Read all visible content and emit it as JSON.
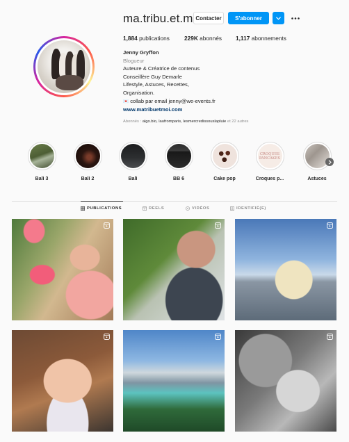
{
  "profile": {
    "username": "ma.tribu.et.moi",
    "contact_label": "Contacter",
    "follow_label": "S'abonner",
    "stats": {
      "posts_count": "1,884",
      "posts_label": "publications",
      "followers_count": "229K",
      "followers_label": "abonnés",
      "following_count": "1,117",
      "following_label": "abonnements"
    },
    "bio": {
      "name": "Jenny Gryffon",
      "category": "Blogueur",
      "line1": "Auteure & Créatrice de contenus",
      "line2": "Conseillère Guy Demarle",
      "line3": "Lifestyle, Astuces, Recettes,",
      "line4": "Organisation.",
      "line5_emoji": "💌",
      "line5": " collab par email jenny@we-events.fr",
      "website": "www.matribuetmoi.com"
    },
    "followed_by_prefix": "Abonnés : ",
    "followed_by_names": "algo.bio, laufromparis, lesmercredissouslapluie",
    "followed_by_suffix": " et 22 autres"
  },
  "highlights": [
    {
      "label": "Bali 3"
    },
    {
      "label": "Bali 2"
    },
    {
      "label": "Bali"
    },
    {
      "label": "BB 6"
    },
    {
      "label": "Cake pop"
    },
    {
      "label": "Croques p..."
    },
    {
      "label": "Astuces"
    }
  ],
  "highlight_thumb_text": {
    "line1": "CROQUES",
    "line2": "PANCAKES"
  },
  "tabs": {
    "publications": "PUBLICATIONS",
    "reels": "REELS",
    "videos": "VIDÉOS",
    "tagged": "IDENTIFIÉ(E)"
  },
  "icons": {
    "more": "more-options-icon",
    "dropdown": "chevron-down-icon",
    "next": "chevron-right-icon",
    "grid": "grid-icon",
    "reels": "reels-icon",
    "videos": "play-icon",
    "tagged": "tag-icon",
    "reel_badge": "reel-badge-icon"
  },
  "colors": {
    "accent": "#0095f6",
    "link": "#00376b",
    "muted": "#8e8e8e",
    "text": "#262626"
  }
}
